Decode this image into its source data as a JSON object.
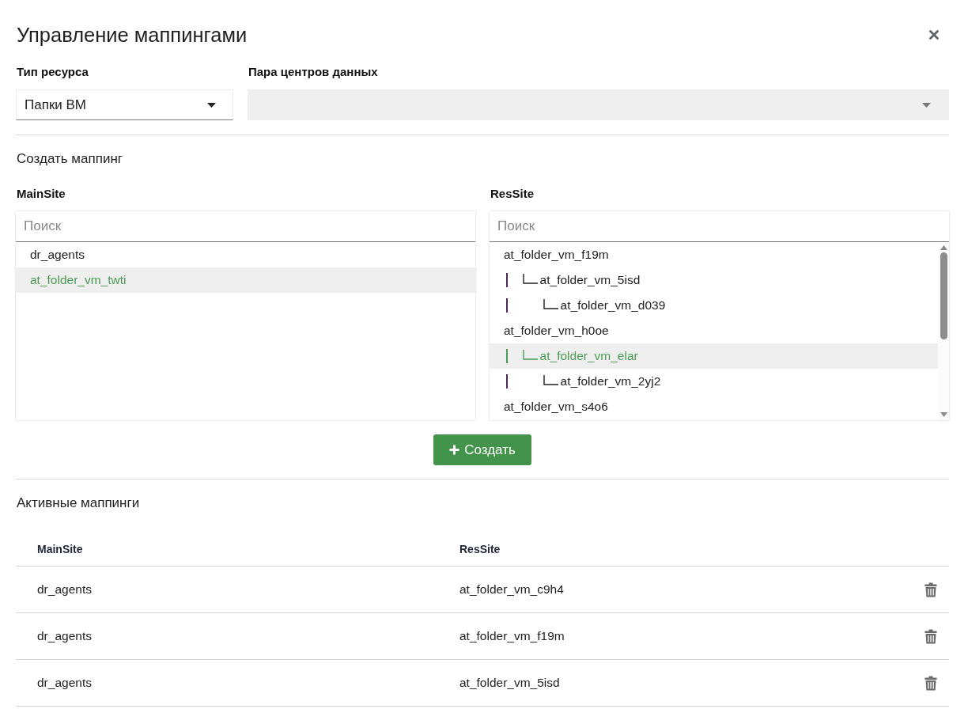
{
  "dialog": {
    "title": "Управление маппингами"
  },
  "filters": [
    {
      "label": "Тип ресурса",
      "value": "Папки ВМ",
      "disabled": false
    },
    {
      "label": "Пара центров данных",
      "disabled": true
    }
  ],
  "create_mapping": {
    "title": "Создать маппинг",
    "panels": [
      {
        "label": "MainSite",
        "placeholder": "Поиск",
        "items": [
          {
            "name": "dr_agents",
            "selected": false
          },
          {
            "name": "at_folder_vm_twti",
            "selected": true
          }
        ]
      },
      {
        "label": "ResSite",
        "placeholder": "Поиск",
        "scrollbar": true,
        "items": [
          {
            "name": "at_folder_vm_f19m",
            "selected": false,
            "children": [
              {
                "name": "at_folder_vm_5isd",
                "selected": false,
                "children": [
                  {
                    "name": "at_folder_vm_d039",
                    "selected": false
                  }
                ]
              }
            ]
          },
          {
            "name": "at_folder_vm_h0oe",
            "selected": false,
            "children": [
              {
                "name": "at_folder_vm_elar",
                "selected": true,
                "children": [
                  {
                    "name": "at_folder_vm_2yj2",
                    "selected": false
                  }
                ]
              }
            ]
          },
          {
            "name": "at_folder_vm_s4o6",
            "selected": false
          }
        ]
      }
    ],
    "create_button": {
      "label": "Создать"
    }
  },
  "active_mappings": {
    "title": "Активные маппинги",
    "columns": [
      "MainSite",
      "ResSite"
    ],
    "rows": [
      {
        "main_site": "dr_agents",
        "res_site": "at_folder_vm_c9h4"
      },
      {
        "main_site": "dr_agents",
        "res_site": "at_folder_vm_f19m"
      },
      {
        "main_site": "dr_agents",
        "res_site": "at_folder_vm_5isd"
      }
    ]
  }
}
